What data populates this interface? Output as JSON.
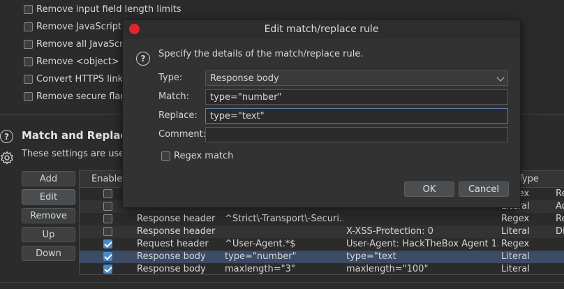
{
  "options": [
    {
      "label": "Remove input field length limits",
      "checked": false
    },
    {
      "label": "Remove JavaScript fo",
      "checked": false
    },
    {
      "label": "Remove all JavaScrip",
      "checked": false
    },
    {
      "label": "Remove <object> tag",
      "checked": false
    },
    {
      "label": "Convert HTTPS links",
      "checked": false
    },
    {
      "label": "Remove secure flag fr",
      "checked": false
    }
  ],
  "section": {
    "title": "Match and Replace",
    "desc": "These settings are used t",
    "buttons": {
      "add": "Add",
      "edit": "Edit",
      "remove": "Remove",
      "up": "Up",
      "down": "Down"
    }
  },
  "table": {
    "headers": {
      "enabled": "Enabled",
      "type": "Type"
    },
    "rows": [
      {
        "enabled": false,
        "item": "",
        "match": "",
        "replace": "",
        "type": "Regex",
        "comment": "Re"
      },
      {
        "enabled": false,
        "item": "",
        "match": "",
        "replace": "",
        "type": "Literal",
        "comment": "Ad"
      },
      {
        "enabled": false,
        "item": "Response header",
        "match": "^Strict\\-Transport\\-Securi...",
        "replace": "",
        "type": "Regex",
        "comment": "Re"
      },
      {
        "enabled": false,
        "item": "Response header",
        "match": "",
        "replace": "X-XSS-Protection: 0",
        "type": "Literal",
        "comment": "Di"
      },
      {
        "enabled": true,
        "item": "Request header",
        "match": "^User-Agent.*$",
        "replace": "User-Agent: HackTheBox Agent 1.0",
        "type": "Regex",
        "comment": ""
      },
      {
        "enabled": true,
        "item": "Response body",
        "match": "type=\"number\"",
        "replace": "type=\"text",
        "type": "Literal",
        "comment": ""
      },
      {
        "enabled": true,
        "item": "Response body",
        "match": "maxlength=\"3\"",
        "replace": "maxlength=\"100\"",
        "type": "Literal",
        "comment": ""
      }
    ]
  },
  "dialog": {
    "title": "Edit match/replace rule",
    "description": "Specify the details of the match/replace rule.",
    "type_label": "Type:",
    "type_value": "Response body",
    "match_label": "Match:",
    "match_value": "type=\"number\"",
    "replace_label": "Replace:",
    "replace_value": "type=\"text\"",
    "comment_label": "Comment:",
    "comment_value": "",
    "regex_label": "Regex match",
    "regex_checked": false,
    "ok_label": "OK",
    "cancel_label": "Cancel"
  },
  "colors": {
    "accent": "#4a88c7",
    "close": "#e0262c",
    "selected_row": "#3c4b66"
  }
}
